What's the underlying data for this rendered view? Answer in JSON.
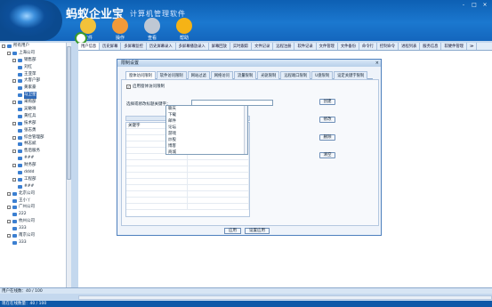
{
  "header": {
    "app_name": "蚂蚁企业宝",
    "subtitle": "计算机管理软件",
    "window_controls": [
      "-",
      "□",
      "×"
    ],
    "toolbar": [
      {
        "label": "文件",
        "icon": "folder-icon",
        "color": "#f2c23a"
      },
      {
        "label": "操作",
        "icon": "gear-icon",
        "color": "#f29a3a"
      },
      {
        "label": "查看",
        "icon": "search-icon",
        "color": "#bfc8d4"
      },
      {
        "label": "帮助",
        "icon": "help-icon",
        "color": "#f5b316"
      }
    ]
  },
  "tabs": [
    "用户信息",
    "历史屏幕",
    "多屏幕监控",
    "历史屏幕录入",
    "多屏幕播放录入",
    "屏幕回放",
    "实时跟踪",
    "文件记录",
    "远程注册",
    "软件记录",
    "文件管理",
    "文件备份",
    "命令行",
    "控制命令",
    "进程列表",
    "服务信息",
    "软硬件管理",
    "≫"
  ],
  "sidebar": {
    "items": [
      {
        "label": "所有用户",
        "level": 0,
        "expander": "-"
      },
      {
        "label": "上海公司",
        "level": 1,
        "expander": "-"
      },
      {
        "label": "销售部",
        "level": 2,
        "expander": "-"
      },
      {
        "label": "刘红",
        "level": 3
      },
      {
        "label": "王亚萍",
        "level": 3
      },
      {
        "label": "大客户部",
        "level": 2,
        "expander": "-"
      },
      {
        "label": "黄家豪",
        "level": 3
      },
      {
        "label": "马卫星",
        "level": 3,
        "selected": true
      },
      {
        "label": "采购部",
        "level": 2,
        "expander": "-"
      },
      {
        "label": "吴敏祥",
        "level": 3
      },
      {
        "label": "黄红兵",
        "level": 3
      },
      {
        "label": "技术部",
        "level": 2,
        "expander": "-"
      },
      {
        "label": "张志勇",
        "level": 3
      },
      {
        "label": "综合管理部",
        "level": 2,
        "expander": "-"
      },
      {
        "label": "林志斌",
        "level": 3
      },
      {
        "label": "售后服务",
        "level": 2,
        "expander": "-"
      },
      {
        "label": "###",
        "level": 3
      },
      {
        "label": "财务部",
        "level": 2,
        "expander": "-"
      },
      {
        "label": "dddd",
        "level": 3
      },
      {
        "label": "工程部",
        "level": 2,
        "expander": "-"
      },
      {
        "label": "###",
        "level": 3
      },
      {
        "label": "北京公司",
        "level": 1,
        "expander": "-"
      },
      {
        "label": "王小丫",
        "level": 2
      },
      {
        "label": "广州公司",
        "level": 1,
        "expander": "-"
      },
      {
        "label": "222",
        "level": 2
      },
      {
        "label": "杭州公司",
        "level": 1,
        "expander": "-"
      },
      {
        "label": "333",
        "level": 2
      },
      {
        "label": "南京公司",
        "level": 1,
        "expander": "-"
      },
      {
        "label": "333",
        "level": 2
      }
    ]
  },
  "dialog": {
    "title": "限制设置",
    "close": "×",
    "tabs": [
      "窗体访问限制",
      "软件访问限制",
      "网站过滤",
      "网络访问",
      "流量限制",
      "光驱限制",
      "远程端口限制",
      "U盘限制",
      "设定关键字限制"
    ],
    "active_tab": 0,
    "enable_label": "启用窗体访问限制",
    "enable_checked": true,
    "keyword_label": "选择或修改标题关键字：",
    "dropdown_options": [
      "聊天",
      "下载",
      "邮件",
      "论坛",
      "游戏",
      "炒股",
      "博客",
      "商城"
    ],
    "grid_header": "",
    "grid_rows": [
      [
        "关键字"
      ],
      [
        ""
      ],
      [
        ""
      ],
      [
        ""
      ],
      [
        ""
      ],
      [
        ""
      ],
      [
        ""
      ],
      [
        ""
      ],
      [
        ""
      ],
      [
        ""
      ],
      [
        ""
      ],
      [
        ""
      ],
      [
        ""
      ],
      [
        ""
      ]
    ],
    "side_buttons": [
      "创建",
      "修改",
      "删除",
      "清空"
    ],
    "bottom_buttons": [
      "应用",
      "设置应用"
    ]
  },
  "status": {
    "users_online": "用户在线数：40 / 100",
    "bottom": "现在在线数量：40 / 100"
  },
  "colors": {
    "accent": "#1466bd",
    "selection": "#2f6ab8"
  }
}
